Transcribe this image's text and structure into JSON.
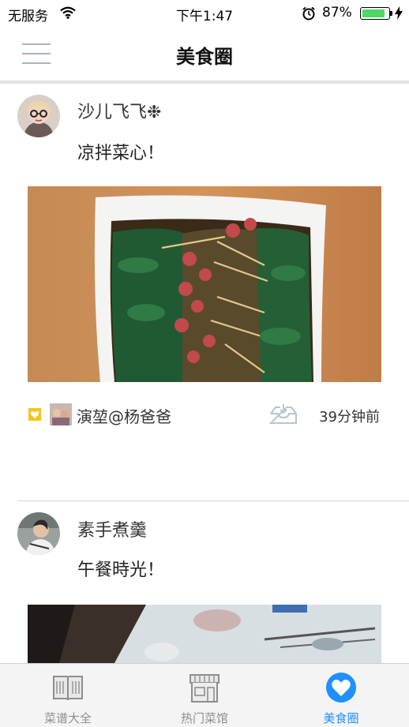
{
  "status_bar": {
    "carrier": "无服务",
    "time": "下午1:47",
    "battery_percent": "87%",
    "battery_level": 0.87
  },
  "nav": {
    "title": "美食圈"
  },
  "posts": [
    {
      "username": "沙儿飞飞❉",
      "text": "凉拌菜心！",
      "liker": "演堃@杨爸爸",
      "time_ago": "39分钟前"
    },
    {
      "username": "素手煮羹",
      "text": "午餐時光！"
    }
  ],
  "tabs": [
    {
      "label": "菜谱大全",
      "icon": "book-icon"
    },
    {
      "label": "热门菜馆",
      "icon": "storefront-icon"
    },
    {
      "label": "美食圈",
      "icon": "heart-icon",
      "active": true
    }
  ],
  "colors": {
    "accent": "#1e90ff",
    "battery": "#4cd964",
    "like": "#f5c518"
  }
}
